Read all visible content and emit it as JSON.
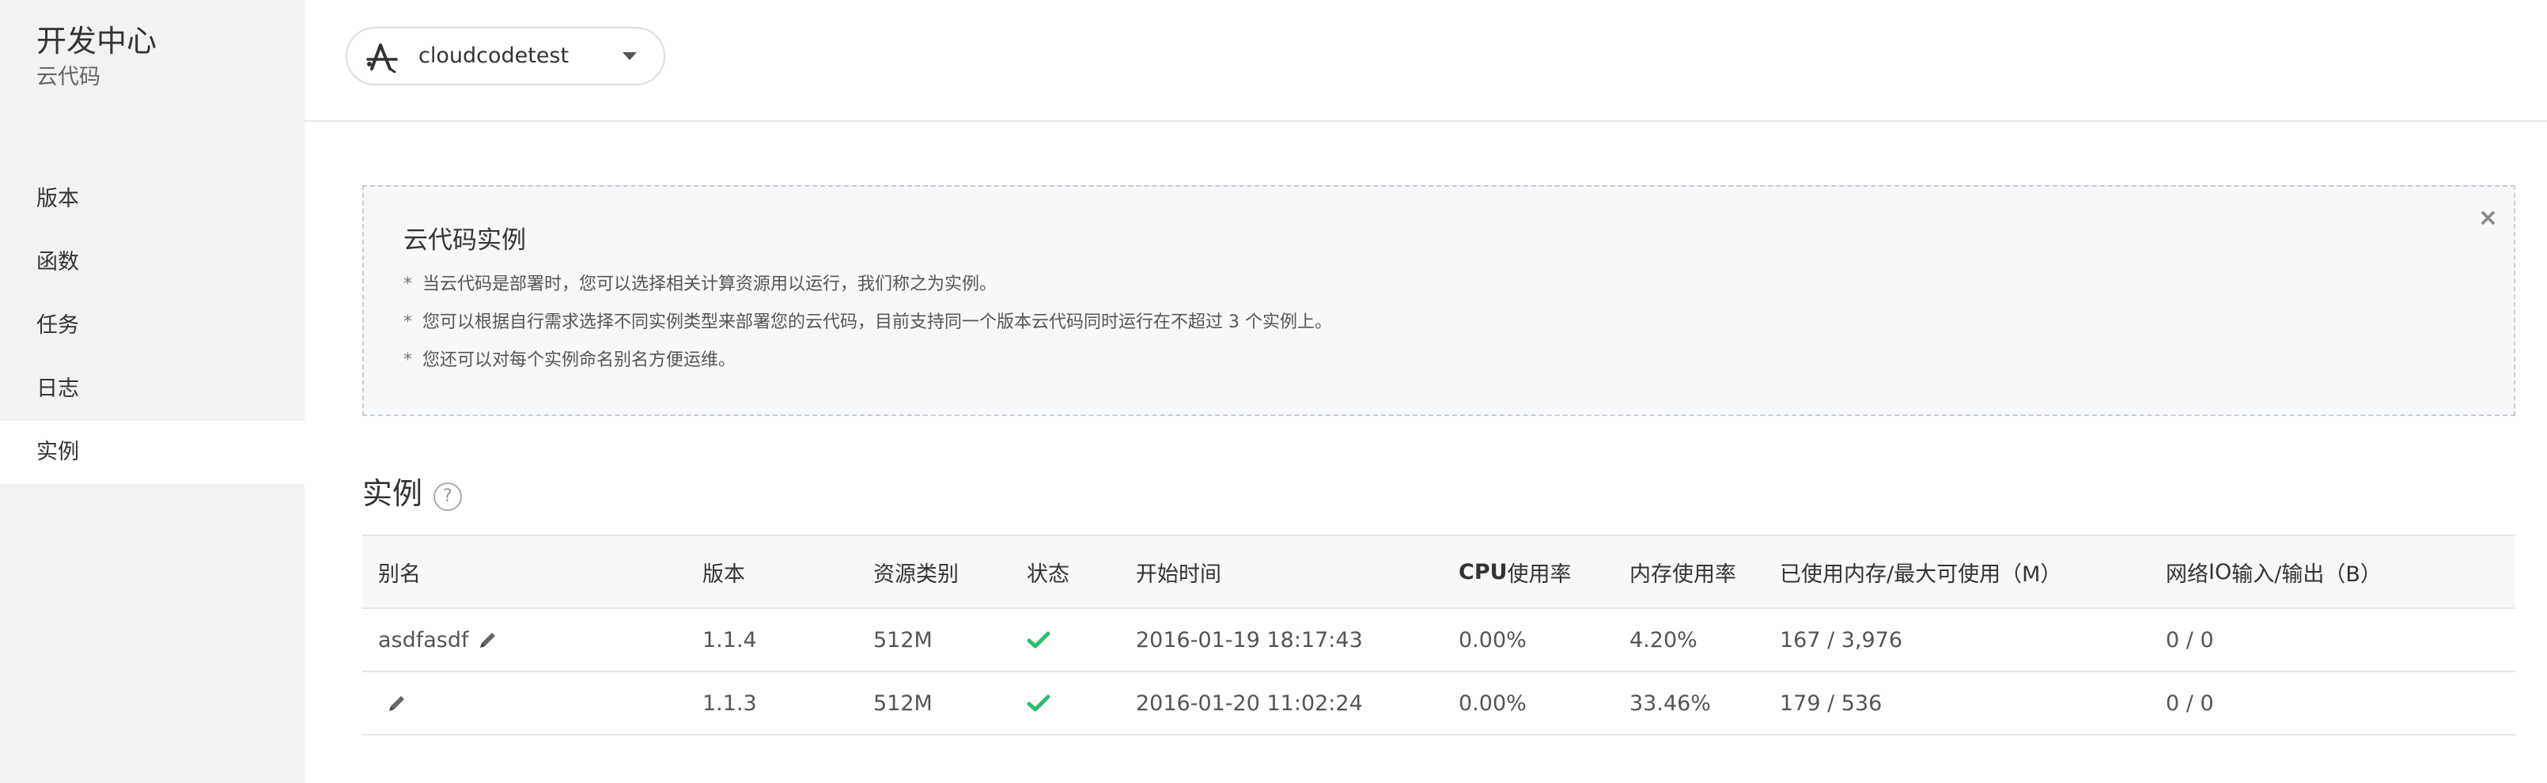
{
  "brand": {
    "title": "开发中心",
    "subtitle": "云代码"
  },
  "nav": {
    "items": [
      {
        "label": "版本"
      },
      {
        "label": "函数"
      },
      {
        "label": "任务"
      },
      {
        "label": "日志"
      },
      {
        "label": "实例"
      }
    ],
    "active_index": 4
  },
  "header": {
    "app_name": "cloudcodetest",
    "app_icon": "app-store-icon"
  },
  "info": {
    "title": "云代码实例",
    "items": [
      "当云代码是部署时，您可以选择相关计算资源用以运行，我们称之为实例。",
      "您可以根据自行需求选择不同实例类型来部署您的云代码，目前支持同一个版本云代码同时运行在不超过 3 个实例上。",
      "您还可以对每个实例命名别名方便运维。"
    ],
    "close_label": "×"
  },
  "section": {
    "title": "实例",
    "help_label": "?"
  },
  "table": {
    "headers": {
      "alias": "别名",
      "version": "版本",
      "resource": "资源类别",
      "status": "状态",
      "start_time": "开始时间",
      "cpu_prefix": "CPU",
      "cpu_suffix": "使用率",
      "mem": "内存使用率",
      "mem_used": "已使用内存/最大可使用（M）",
      "netio_prefix": "网络",
      "netio_io": "IO",
      "netio_suffix": " 输入/输出（B）"
    },
    "rows": [
      {
        "alias": "asdfasdf",
        "version": "1.1.4",
        "resource": "512M",
        "status": "ok",
        "start_time": "2016-01-19 18:17:43",
        "cpu": "0.00%",
        "mem": "4.20%",
        "mem_used": "167 / 3,976",
        "netio": "0 / 0"
      },
      {
        "alias": "",
        "version": "1.1.3",
        "resource": "512M",
        "status": "ok",
        "start_time": "2016-01-20 11:02:24",
        "cpu": "0.00%",
        "mem": "33.46%",
        "mem_used": "179 / 536",
        "netio": "0 / 0"
      }
    ]
  },
  "colors": {
    "success": "#2dbd6e",
    "sidebar_bg": "#f1f2f4",
    "info_bg": "#f7f8fa"
  }
}
